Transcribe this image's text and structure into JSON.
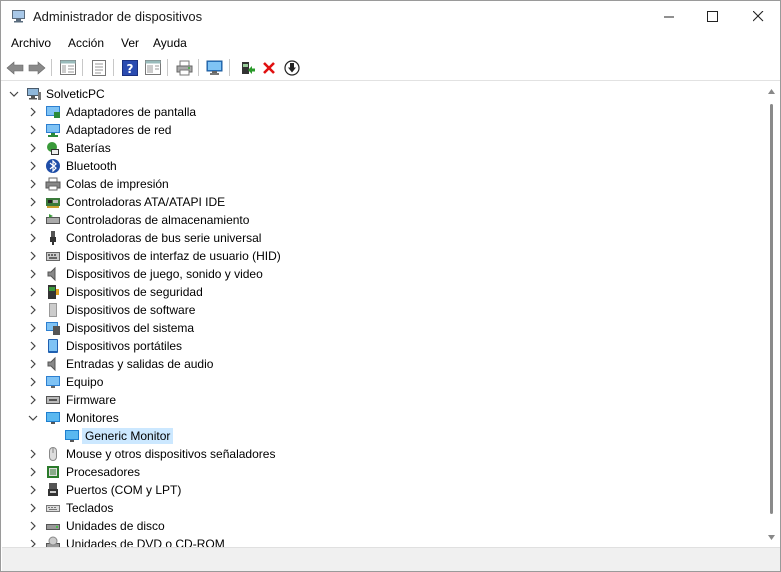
{
  "window": {
    "title": "Administrador de dispositivos"
  },
  "menu": [
    "Archivo",
    "Acción",
    "Ver",
    "Ayuda"
  ],
  "tree": {
    "root": "SolveticPC",
    "categories": [
      "Adaptadores de pantalla",
      "Adaptadores de red",
      "Baterías",
      "Bluetooth",
      "Colas de impresión",
      "Controladoras ATA/ATAPI IDE",
      "Controladoras de almacenamiento",
      "Controladoras de bus serie universal",
      "Dispositivos de interfaz de usuario (HID)",
      "Dispositivos de juego, sonido y video",
      "Dispositivos de seguridad",
      "Dispositivos de software",
      "Dispositivos del sistema",
      "Dispositivos portátiles",
      "Entradas y salidas de audio",
      "Equipo",
      "Firmware",
      "Monitores",
      "Mouse y otros dispositivos señaladores",
      "Procesadores",
      "Puertos (COM y LPT)",
      "Teclados",
      "Unidades de disco",
      "Unidades de DVD o CD-ROM"
    ],
    "expanded_child": "Generic Monitor"
  }
}
